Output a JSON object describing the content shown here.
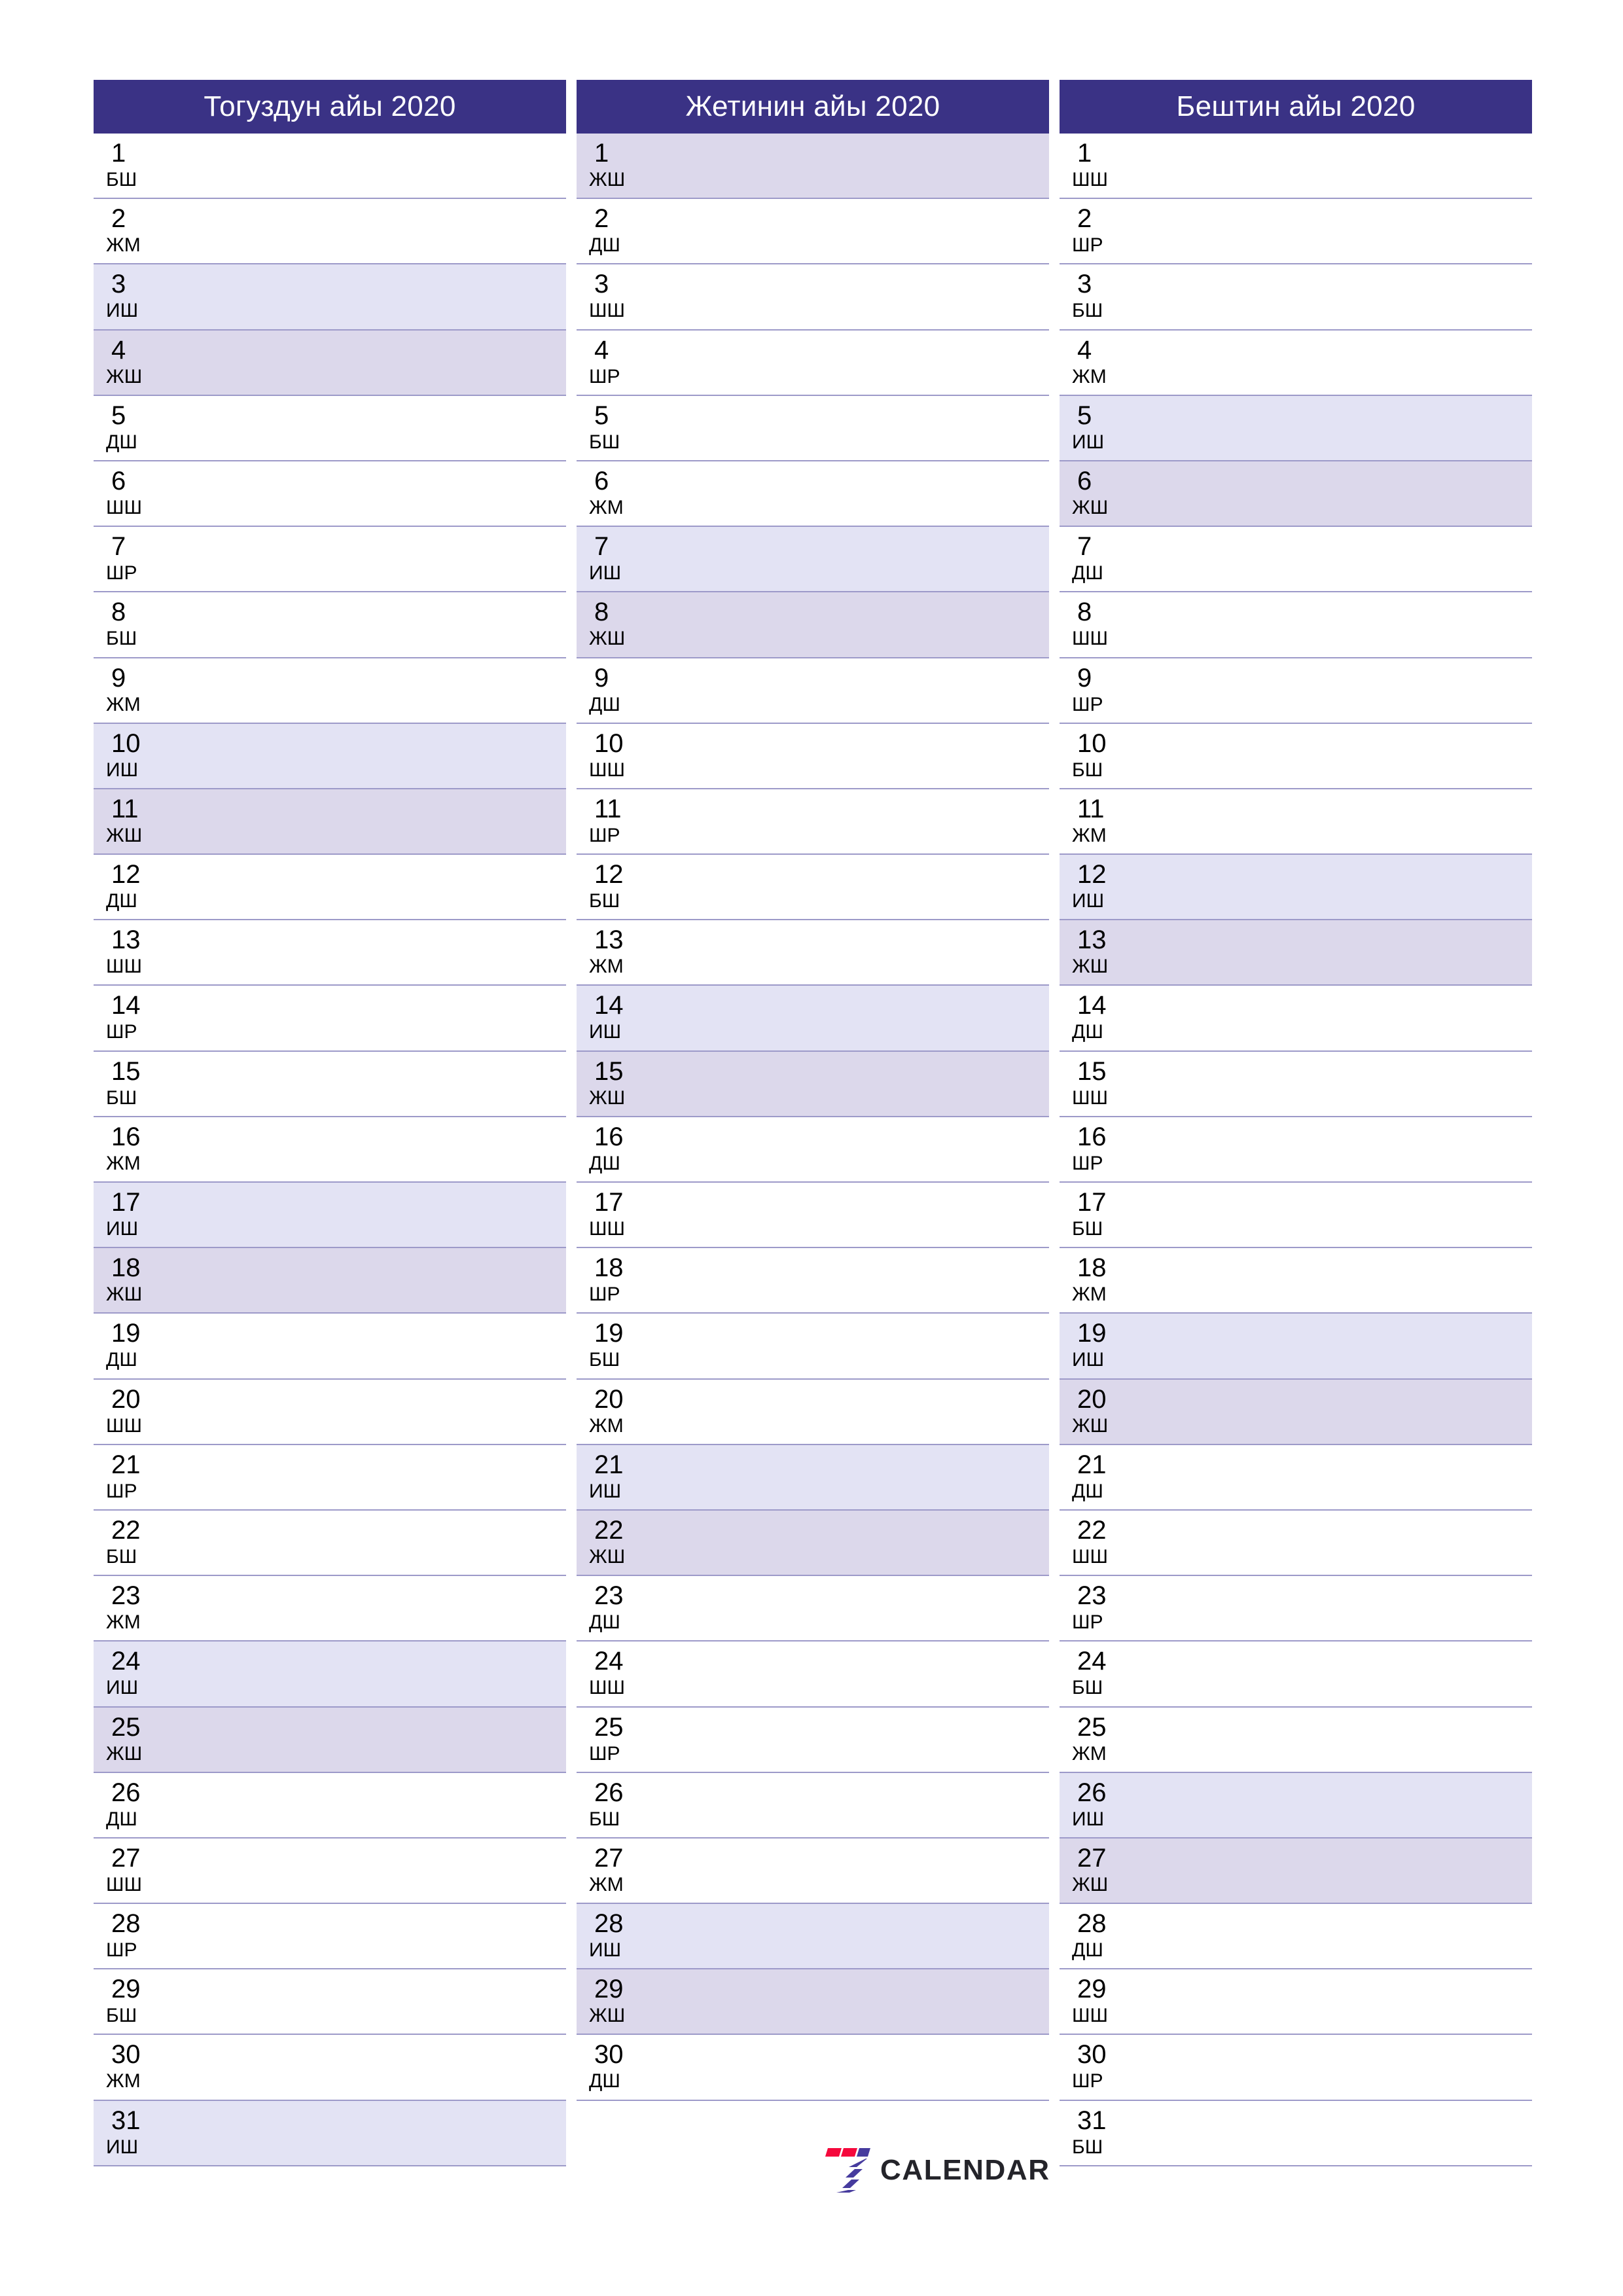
{
  "theme": {
    "header_bg": "#3a3285",
    "header_text": "#ffffff",
    "grid_line": "#9d9ac9",
    "saturday_bg": "#e3e3f4",
    "sunday_bg": "#dcd8eb",
    "page_bg": "#ffffff",
    "day_text": "#000000"
  },
  "logo": {
    "name": "7calendar-logo",
    "text": "CALENDAR",
    "mark_digit": "7",
    "mark_colors": [
      "#f5083c",
      "#463b9e"
    ]
  },
  "months": [
    {
      "title": "Тогуздун айы 2020",
      "days": [
        {
          "num": "1",
          "wd": "БШ",
          "type": "weekday"
        },
        {
          "num": "2",
          "wd": "ЖМ",
          "type": "weekday"
        },
        {
          "num": "3",
          "wd": "ИШ",
          "type": "sat"
        },
        {
          "num": "4",
          "wd": "ЖШ",
          "type": "sun"
        },
        {
          "num": "5",
          "wd": "ДШ",
          "type": "weekday"
        },
        {
          "num": "6",
          "wd": "ШШ",
          "type": "weekday"
        },
        {
          "num": "7",
          "wd": "ШР",
          "type": "weekday"
        },
        {
          "num": "8",
          "wd": "БШ",
          "type": "weekday"
        },
        {
          "num": "9",
          "wd": "ЖМ",
          "type": "weekday"
        },
        {
          "num": "10",
          "wd": "ИШ",
          "type": "sat"
        },
        {
          "num": "11",
          "wd": "ЖШ",
          "type": "sun"
        },
        {
          "num": "12",
          "wd": "ДШ",
          "type": "weekday"
        },
        {
          "num": "13",
          "wd": "ШШ",
          "type": "weekday"
        },
        {
          "num": "14",
          "wd": "ШР",
          "type": "weekday"
        },
        {
          "num": "15",
          "wd": "БШ",
          "type": "weekday"
        },
        {
          "num": "16",
          "wd": "ЖМ",
          "type": "weekday"
        },
        {
          "num": "17",
          "wd": "ИШ",
          "type": "sat"
        },
        {
          "num": "18",
          "wd": "ЖШ",
          "type": "sun"
        },
        {
          "num": "19",
          "wd": "ДШ",
          "type": "weekday"
        },
        {
          "num": "20",
          "wd": "ШШ",
          "type": "weekday"
        },
        {
          "num": "21",
          "wd": "ШР",
          "type": "weekday"
        },
        {
          "num": "22",
          "wd": "БШ",
          "type": "weekday"
        },
        {
          "num": "23",
          "wd": "ЖМ",
          "type": "weekday"
        },
        {
          "num": "24",
          "wd": "ИШ",
          "type": "sat"
        },
        {
          "num": "25",
          "wd": "ЖШ",
          "type": "sun"
        },
        {
          "num": "26",
          "wd": "ДШ",
          "type": "weekday"
        },
        {
          "num": "27",
          "wd": "ШШ",
          "type": "weekday"
        },
        {
          "num": "28",
          "wd": "ШР",
          "type": "weekday"
        },
        {
          "num": "29",
          "wd": "БШ",
          "type": "weekday"
        },
        {
          "num": "30",
          "wd": "ЖМ",
          "type": "weekday"
        },
        {
          "num": "31",
          "wd": "ИШ",
          "type": "sat"
        }
      ]
    },
    {
      "title": "Жетинин айы 2020",
      "days": [
        {
          "num": "1",
          "wd": "ЖШ",
          "type": "sun"
        },
        {
          "num": "2",
          "wd": "ДШ",
          "type": "weekday"
        },
        {
          "num": "3",
          "wd": "ШШ",
          "type": "weekday"
        },
        {
          "num": "4",
          "wd": "ШР",
          "type": "weekday"
        },
        {
          "num": "5",
          "wd": "БШ",
          "type": "weekday"
        },
        {
          "num": "6",
          "wd": "ЖМ",
          "type": "weekday"
        },
        {
          "num": "7",
          "wd": "ИШ",
          "type": "sat"
        },
        {
          "num": "8",
          "wd": "ЖШ",
          "type": "sun"
        },
        {
          "num": "9",
          "wd": "ДШ",
          "type": "weekday"
        },
        {
          "num": "10",
          "wd": "ШШ",
          "type": "weekday"
        },
        {
          "num": "11",
          "wd": "ШР",
          "type": "weekday"
        },
        {
          "num": "12",
          "wd": "БШ",
          "type": "weekday"
        },
        {
          "num": "13",
          "wd": "ЖМ",
          "type": "weekday"
        },
        {
          "num": "14",
          "wd": "ИШ",
          "type": "sat"
        },
        {
          "num": "15",
          "wd": "ЖШ",
          "type": "sun"
        },
        {
          "num": "16",
          "wd": "ДШ",
          "type": "weekday"
        },
        {
          "num": "17",
          "wd": "ШШ",
          "type": "weekday"
        },
        {
          "num": "18",
          "wd": "ШР",
          "type": "weekday"
        },
        {
          "num": "19",
          "wd": "БШ",
          "type": "weekday"
        },
        {
          "num": "20",
          "wd": "ЖМ",
          "type": "weekday"
        },
        {
          "num": "21",
          "wd": "ИШ",
          "type": "sat"
        },
        {
          "num": "22",
          "wd": "ЖШ",
          "type": "sun"
        },
        {
          "num": "23",
          "wd": "ДШ",
          "type": "weekday"
        },
        {
          "num": "24",
          "wd": "ШШ",
          "type": "weekday"
        },
        {
          "num": "25",
          "wd": "ШР",
          "type": "weekday"
        },
        {
          "num": "26",
          "wd": "БШ",
          "type": "weekday"
        },
        {
          "num": "27",
          "wd": "ЖМ",
          "type": "weekday"
        },
        {
          "num": "28",
          "wd": "ИШ",
          "type": "sat"
        },
        {
          "num": "29",
          "wd": "ЖШ",
          "type": "sun"
        },
        {
          "num": "30",
          "wd": "ДШ",
          "type": "weekday"
        }
      ]
    },
    {
      "title": "Бештин айы 2020",
      "days": [
        {
          "num": "1",
          "wd": "ШШ",
          "type": "weekday"
        },
        {
          "num": "2",
          "wd": "ШР",
          "type": "weekday"
        },
        {
          "num": "3",
          "wd": "БШ",
          "type": "weekday"
        },
        {
          "num": "4",
          "wd": "ЖМ",
          "type": "weekday"
        },
        {
          "num": "5",
          "wd": "ИШ",
          "type": "sat"
        },
        {
          "num": "6",
          "wd": "ЖШ",
          "type": "sun"
        },
        {
          "num": "7",
          "wd": "ДШ",
          "type": "weekday"
        },
        {
          "num": "8",
          "wd": "ШШ",
          "type": "weekday"
        },
        {
          "num": "9",
          "wd": "ШР",
          "type": "weekday"
        },
        {
          "num": "10",
          "wd": "БШ",
          "type": "weekday"
        },
        {
          "num": "11",
          "wd": "ЖМ",
          "type": "weekday"
        },
        {
          "num": "12",
          "wd": "ИШ",
          "type": "sat"
        },
        {
          "num": "13",
          "wd": "ЖШ",
          "type": "sun"
        },
        {
          "num": "14",
          "wd": "ДШ",
          "type": "weekday"
        },
        {
          "num": "15",
          "wd": "ШШ",
          "type": "weekday"
        },
        {
          "num": "16",
          "wd": "ШР",
          "type": "weekday"
        },
        {
          "num": "17",
          "wd": "БШ",
          "type": "weekday"
        },
        {
          "num": "18",
          "wd": "ЖМ",
          "type": "weekday"
        },
        {
          "num": "19",
          "wd": "ИШ",
          "type": "sat"
        },
        {
          "num": "20",
          "wd": "ЖШ",
          "type": "sun"
        },
        {
          "num": "21",
          "wd": "ДШ",
          "type": "weekday"
        },
        {
          "num": "22",
          "wd": "ШШ",
          "type": "weekday"
        },
        {
          "num": "23",
          "wd": "ШР",
          "type": "weekday"
        },
        {
          "num": "24",
          "wd": "БШ",
          "type": "weekday"
        },
        {
          "num": "25",
          "wd": "ЖМ",
          "type": "weekday"
        },
        {
          "num": "26",
          "wd": "ИШ",
          "type": "sat"
        },
        {
          "num": "27",
          "wd": "ЖШ",
          "type": "sun"
        },
        {
          "num": "28",
          "wd": "ДШ",
          "type": "weekday"
        },
        {
          "num": "29",
          "wd": "ШШ",
          "type": "weekday"
        },
        {
          "num": "30",
          "wd": "ШР",
          "type": "weekday"
        },
        {
          "num": "31",
          "wd": "БШ",
          "type": "weekday"
        }
      ]
    }
  ]
}
